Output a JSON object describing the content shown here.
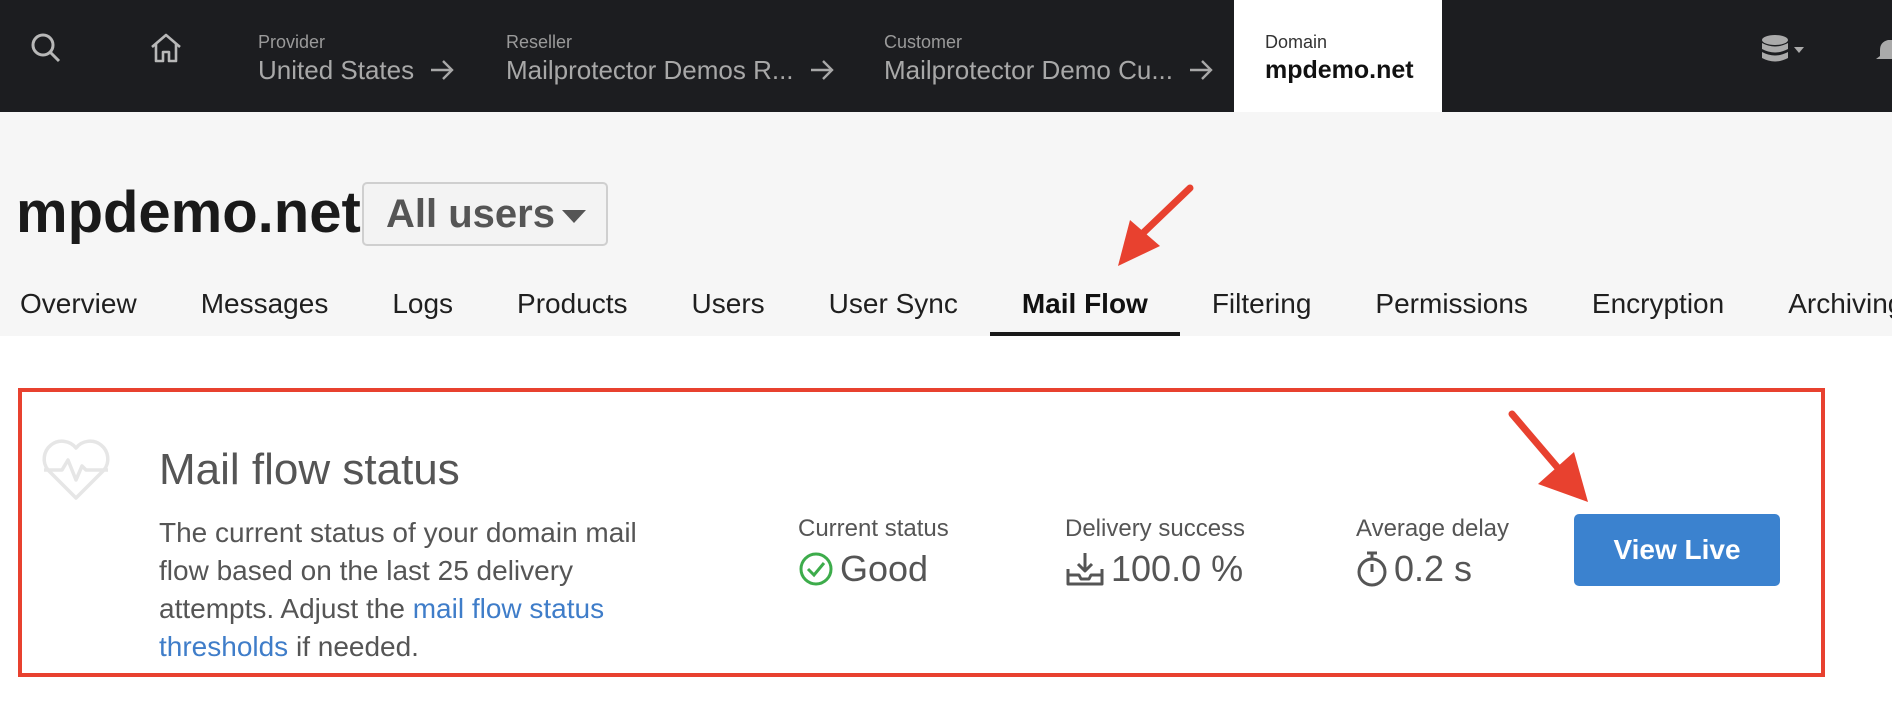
{
  "nav": {
    "icons": [
      "search-icon",
      "home-icon",
      "database-icon",
      "bell-icon"
    ],
    "breadcrumbs": [
      {
        "label": "Provider",
        "value": "United States"
      },
      {
        "label": "Reseller",
        "value": "Mailprotector Demos R..."
      },
      {
        "label": "Customer",
        "value": "Mailprotector Demo Cu..."
      },
      {
        "label": "Domain",
        "value": "mpdemo.net"
      }
    ]
  },
  "header": {
    "title": "mpdemo.net",
    "user_filter": "All users",
    "tabs": [
      "Overview",
      "Messages",
      "Logs",
      "Products",
      "Users",
      "User Sync",
      "Mail Flow",
      "Filtering",
      "Permissions",
      "Encryption",
      "Archiving"
    ],
    "active_tab": "Mail Flow"
  },
  "status_card": {
    "icon": "heartbeat-icon",
    "title": "Mail flow status",
    "desc_before": "The current status of your domain mail flow based on the last 25 delivery attempts. Adjust the ",
    "desc_link": "mail flow status thresholds",
    "desc_after": " if needed.",
    "metrics": [
      {
        "label": "Current status",
        "value": "Good",
        "icon": "check-circle-icon"
      },
      {
        "label": "Delivery success",
        "value": "100.0 %",
        "icon": "inbox-download-icon"
      },
      {
        "label": "Average delay",
        "value": "0.2 s",
        "icon": "stopwatch-icon"
      }
    ],
    "button_label": "View Live"
  },
  "colors": {
    "nav_bg": "#1c1d20",
    "accent_blue": "#3b82cf",
    "annotation_red": "#e8412f",
    "good_green": "#3dac4b"
  }
}
